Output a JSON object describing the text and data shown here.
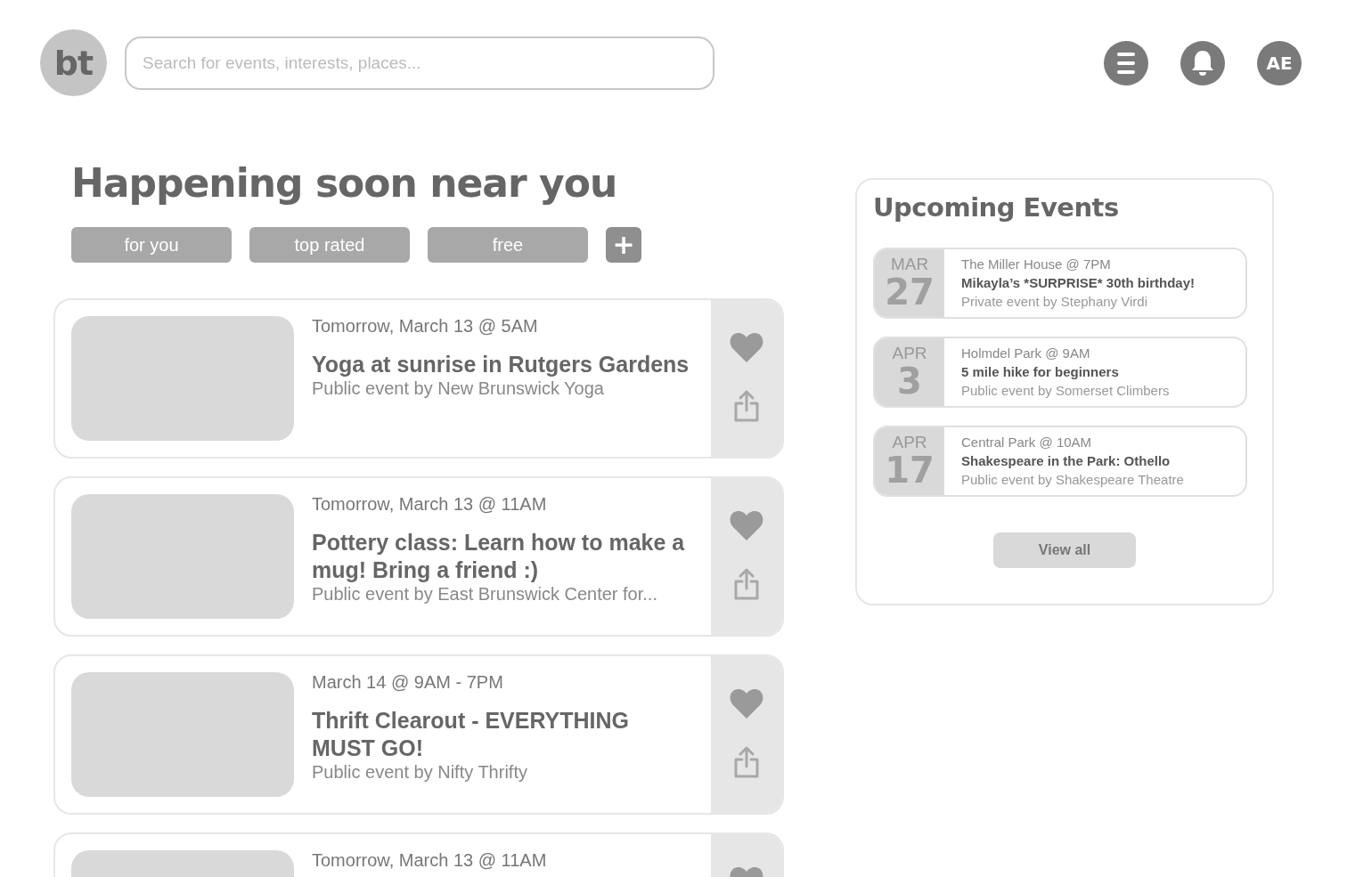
{
  "header": {
    "logo": "bt",
    "search": {
      "placeholder": "Search for events, interests, places..."
    },
    "avatar": "AE"
  },
  "heading": "Happening soon near you",
  "filters": [
    "for you",
    "top rated",
    "free"
  ],
  "add_filter": "+",
  "events": [
    {
      "date": "Tomorrow, March 13 @ 5AM",
      "title": "Yoga at sunrise in Rutgers Gardens",
      "host": "Public event by New Brunswick Yoga"
    },
    {
      "date": "Tomorrow, March 13 @ 11AM",
      "title": "Pottery class: Learn how to make a mug! Bring a friend :)",
      "host": "Public event by East Brunswick Center for..."
    },
    {
      "date": "March 14 @ 9AM - 7PM",
      "title": "Thrift Clearout - EVERYTHING MUST GO!",
      "host": "Public event by Nifty Thrifty"
    },
    {
      "date": "Tomorrow, March 13 @ 11AM"
    }
  ],
  "upcoming": {
    "title": "Upcoming Events",
    "items": [
      {
        "month": "MAR",
        "day": "27",
        "place": "The Miller House @ 7PM",
        "name": "Mikayla’s *SURPRISE* 30th birthday!",
        "host": "Private event by Stephany Virdi"
      },
      {
        "month": "APR",
        "day": "3",
        "place": "Holmdel Park @ 9AM",
        "name": "5 mile hike for beginners",
        "host": "Public event by Somerset Climbers"
      },
      {
        "month": "APR",
        "day": "17",
        "place": "Central Park @ 10AM",
        "name": "Shakespeare in the Park: Othello",
        "host": "Public event by Shakespeare Theatre"
      }
    ],
    "button": "View all"
  }
}
